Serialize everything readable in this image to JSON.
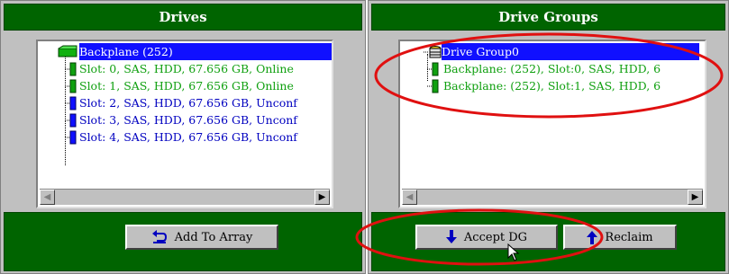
{
  "left_panel": {
    "title": "Drives",
    "tree": [
      {
        "label": "Backplane (252)",
        "icon": "backplane-icon",
        "selected": true
      },
      {
        "label": "Slot: 0, SAS, HDD, 67.656 GB, Online",
        "icon": "drive-online-icon",
        "color": "#10a010"
      },
      {
        "label": "Slot: 1, SAS, HDD, 67.656 GB, Online",
        "icon": "drive-online-icon",
        "color": "#10a010"
      },
      {
        "label": "Slot: 2, SAS, HDD, 67.656 GB, Unconf",
        "icon": "drive-unconf-icon",
        "color": "#0000c0"
      },
      {
        "label": "Slot: 3, SAS, HDD, 67.656 GB, Unconf",
        "icon": "drive-unconf-icon",
        "color": "#0000c0"
      },
      {
        "label": "Slot: 4, SAS, HDD, 67.656 GB, Unconf",
        "icon": "drive-unconf-icon",
        "color": "#0000c0"
      }
    ],
    "button": {
      "label": "Add To Array",
      "icon": "undo-arrow-icon"
    }
  },
  "right_panel": {
    "title": "Drive Groups",
    "tree": [
      {
        "label": "Drive Group0",
        "icon": "drive-group-icon",
        "selected": true
      },
      {
        "label": "Backplane: (252), Slot:0, SAS, HDD, 6",
        "icon": "drive-online-icon",
        "color": "#10a010"
      },
      {
        "label": "Backplane: (252), Slot:1, SAS, HDD, 6",
        "icon": "drive-online-icon",
        "color": "#10a010"
      }
    ],
    "buttons": [
      {
        "label": "Accept DG",
        "icon": "arrow-down-icon"
      },
      {
        "label": "Reclaim",
        "icon": "arrow-up-icon"
      }
    ]
  },
  "colors": {
    "panel_green": "#006400",
    "selection_blue": "#1010ff",
    "highlight_red": "#e01010"
  }
}
